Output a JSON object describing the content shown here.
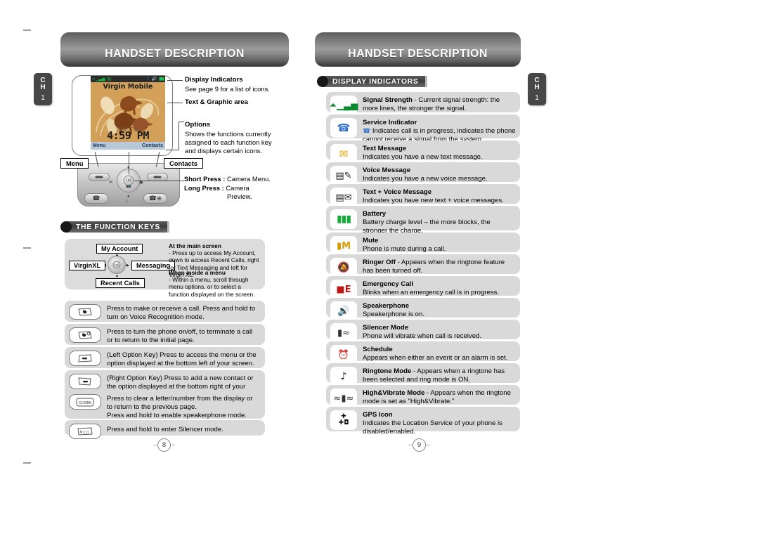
{
  "document": {
    "left_page": {
      "banner_title": "HANDSET DESCRIPTION",
      "chapter_tab": {
        "line1": "C",
        "line2": "H",
        "number": "1"
      },
      "page_number": "8",
      "phone": {
        "screen_title": "Virgin Mobile",
        "date": "7/6 Tue",
        "time": "4:59 PM",
        "softkey_left": "Menu",
        "softkey_right": "Contacts",
        "status_icons": [
          "signal-icon",
          "service-icon",
          "ringtone-icon",
          "speaker-icon",
          "battery-icon"
        ]
      },
      "callouts": [
        {
          "title": "Display Indicators",
          "body": "See page 9 for a list of icons."
        },
        {
          "title": "Text & Graphic area",
          "body": ""
        },
        {
          "title": "Options",
          "body": "Shows the functions currently assigned to each function key and displays certain icons."
        }
      ],
      "key_labels": {
        "menu": "Menu",
        "contacts": "Contacts"
      },
      "press_notes": [
        {
          "label": "Short Press :",
          "value": "Camera Menu."
        },
        {
          "label": "Long Press :",
          "value": "Camera"
        },
        {
          "label": "",
          "value": "Preview."
        }
      ],
      "function_keys_heading": "THE FUNCTION KEYS",
      "function_keys_diagram": {
        "up": "My Account",
        "left": "VirginXL",
        "right": "Messaging",
        "down": "Recent Calls",
        "notes": [
          {
            "heading": "At the main screen",
            "body": "- Press up to access My Account, down to access Recent Calls, right for Text Messaging and left for Virgin XL."
          },
          {
            "heading": "When inside a menu",
            "body": "- Within a menu, scroll through menu options, or to select a function displayed on the screen."
          }
        ]
      },
      "key_rows": [
        {
          "icon": "send-key-icon",
          "text": "Press to make or receive a call. Press and hold to turn on Voice Recognition mode."
        },
        {
          "icon": "end-power-key-icon",
          "text": "Press to turn the phone on/off, to terminate a call or to return to the initial page."
        },
        {
          "icon": "left-option-key-icon",
          "text": "(Left Option Key) Press to access the menu or the option displayed at the bottom left of your screen."
        },
        {
          "icon": "right-option-key-icon",
          "text": "(Right Option Key) Press to add a new contact or the option displayed at the bottom right of your screen."
        },
        {
          "icon": "clear-key-icon",
          "text": "Press to clear a letter/number from the display or to return to the previous page.\nPress and hold to enable speakerphone mode."
        },
        {
          "icon": "pound-key-icon",
          "text": "Press and hold to enter Silencer mode."
        }
      ]
    },
    "right_page": {
      "banner_title": "HANDSET DESCRIPTION",
      "chapter_tab": {
        "line1": "C",
        "line2": "H",
        "number": "1"
      },
      "page_number": "9",
      "section_heading": "DISPLAY INDICATORS",
      "indicators": [
        {
          "icon": "signal-strength-icon",
          "bold": "Signal Strength",
          "sep": " - ",
          "rest": "Current signal strength: the more lines, the stronger the signal."
        },
        {
          "icon": "service-indicator-icon",
          "bold": "Service Indicator",
          "sep": "",
          "rest": "Indicates call is in progress, indicates the phone cannot receive a signal from the system."
        },
        {
          "icon": "text-message-icon",
          "bold": "Text Message",
          "sep": "",
          "rest": "Indicates you have a new text message."
        },
        {
          "icon": "voice-message-icon",
          "bold": "Voice Message",
          "sep": "",
          "rest": "Indicates you have a new voice message."
        },
        {
          "icon": "text-voice-message-icon",
          "bold": "Text + Voice Message",
          "sep": "",
          "rest": "Indicates you have new text + voice messages."
        },
        {
          "icon": "battery-icon",
          "bold": "Battery",
          "sep": "",
          "rest": "Battery charge level – the more blocks, the stronger the charge."
        },
        {
          "icon": "mute-icon",
          "bold": "Mute",
          "sep": "",
          "rest": "Phone is mute during a call."
        },
        {
          "icon": "ringer-off-icon",
          "bold": "Ringer Off",
          "sep": " - ",
          "rest": "Appears when the ringtone feature has been turned off."
        },
        {
          "icon": "emergency-call-icon",
          "bold": "Emergency Call",
          "sep": "",
          "rest": "Blinks when an emergency call is in progress."
        },
        {
          "icon": "speakerphone-icon",
          "bold": "Speakerphone",
          "sep": "",
          "rest": "Speakerphone is on."
        },
        {
          "icon": "silencer-mode-icon",
          "bold": "Silencer Mode",
          "sep": "",
          "rest": "Phone will vibrate when call is received."
        },
        {
          "icon": "schedule-icon",
          "bold": "Schedule",
          "sep": "",
          "rest": "Appears when either an event or an alarm is set."
        },
        {
          "icon": "ringtone-mode-icon",
          "bold": "Ringtone Mode",
          "sep": " - ",
          "rest": "Appears when a ringtone has been selected and ring mode is ON."
        },
        {
          "icon": "high-vibrate-mode-icon",
          "bold": "High&Vibrate Mode",
          "sep": " - ",
          "rest": "Appears when the ringtone mode is set as \"High&Vibrate.\""
        },
        {
          "icon": "gps-icon",
          "bold": "GPS Icon",
          "sep": "",
          "rest": "Indicates the Location Service of your phone is disabled/enabled."
        }
      ]
    }
  },
  "colors": {
    "row_bg": "#d9d9d9",
    "banner_dark": "#3c3c3c",
    "tab_bg": "#474747",
    "screen_bg": "#d3a05a"
  }
}
